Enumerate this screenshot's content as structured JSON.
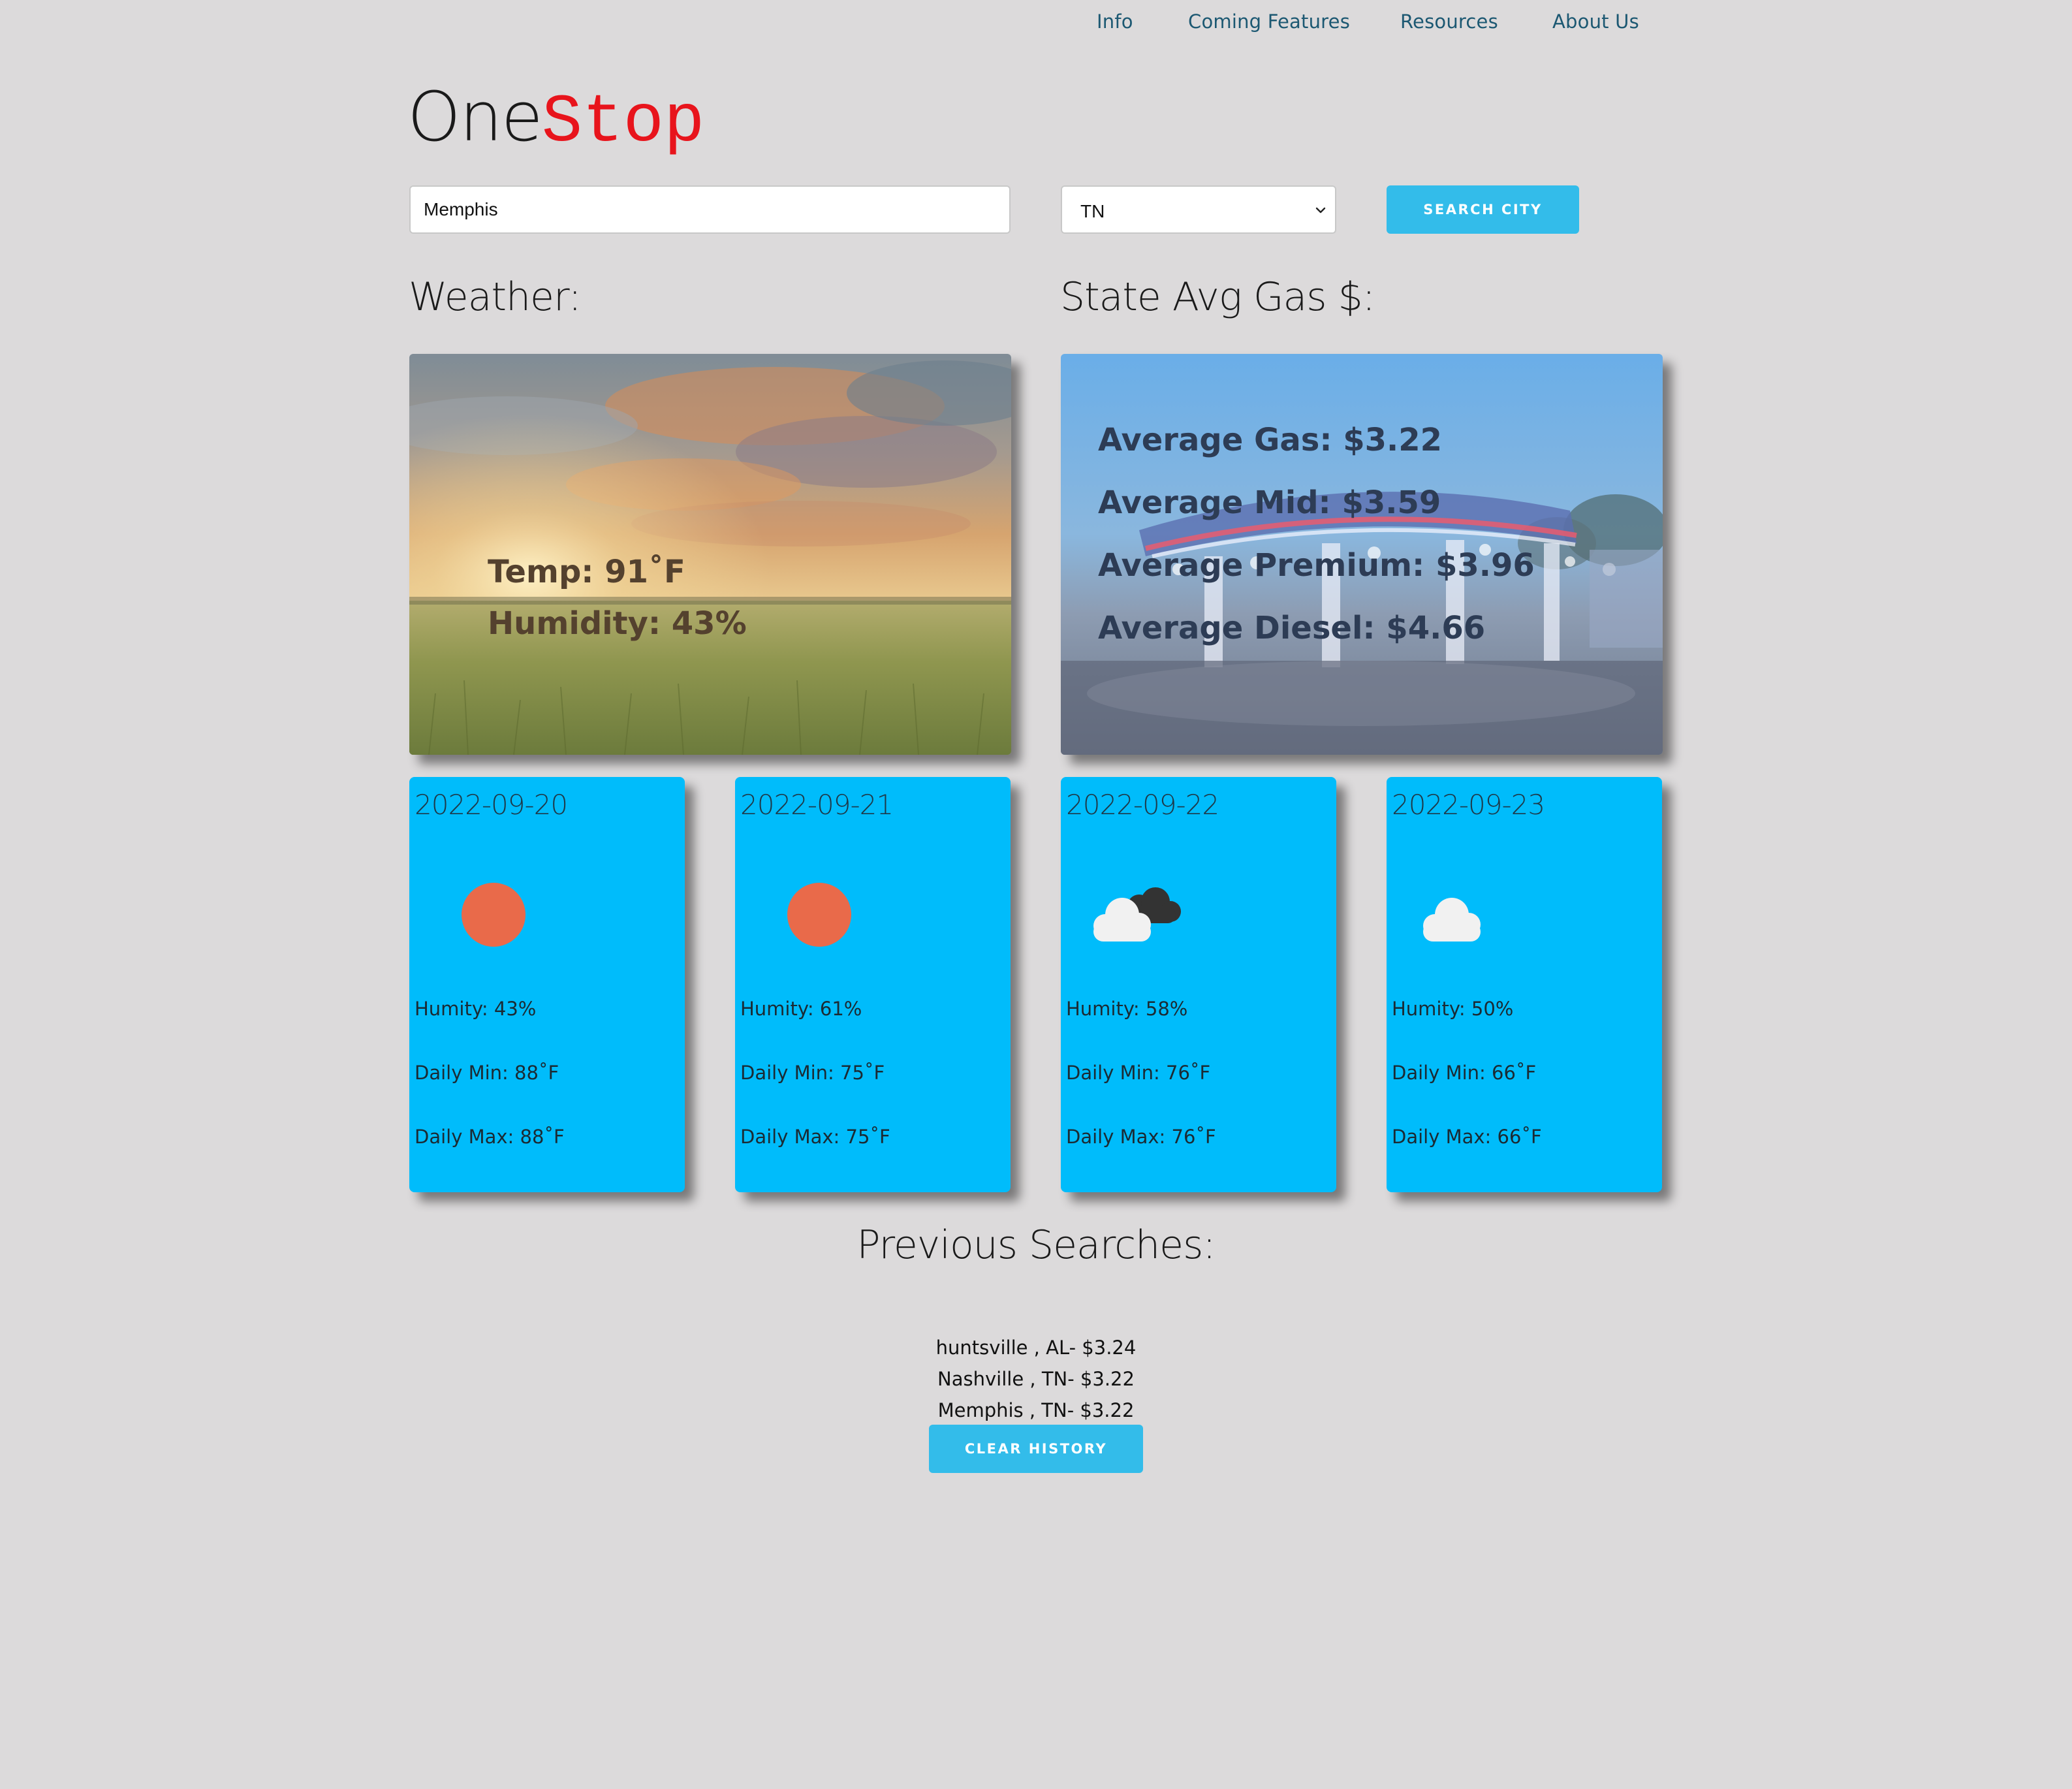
{
  "nav": {
    "items": [
      {
        "label": "Info"
      },
      {
        "label": "Coming Features"
      },
      {
        "label": "Resources"
      },
      {
        "label": "About Us"
      }
    ]
  },
  "logo": {
    "part1": "One",
    "part2": "Stop",
    "part2_color": "#e8141c"
  },
  "search": {
    "city_value": "Memphis",
    "state_selected": "TN",
    "button_label": "SEARCH CITY",
    "button_color": "#33bcea"
  },
  "weather": {
    "heading": "Weather:",
    "temp": "Temp: 91˚F",
    "humidity": "Humidity: 43%"
  },
  "gas": {
    "heading": "State Avg Gas $:",
    "lines": [
      "Average Gas: $3.22",
      "Average Mid: $3.59",
      "Average Premium: $3.96",
      "Average Diesel: $4.66"
    ]
  },
  "forecast": {
    "card_color": "#00bcfb",
    "days": [
      {
        "date": "2022-09-20",
        "icon": "sun-icon",
        "humidity": "Humity: 43%",
        "min": "Daily Min: 88˚F",
        "max": "Daily Max: 88˚F"
      },
      {
        "date": "2022-09-21",
        "icon": "sun-icon",
        "humidity": "Humity: 61%",
        "min": "Daily Min: 75˚F",
        "max": "Daily Max: 75˚F"
      },
      {
        "date": "2022-09-22",
        "icon": "dark-clouds-icon",
        "humidity": "Humity: 58%",
        "min": "Daily Min: 76˚F",
        "max": "Daily Max: 76˚F"
      },
      {
        "date": "2022-09-23",
        "icon": "cloud-icon",
        "humidity": "Humity: 50%",
        "min": "Daily Min: 66˚F",
        "max": "Daily Max: 66˚F"
      }
    ]
  },
  "history": {
    "heading": "Previous Searches:",
    "items": [
      "huntsville , AL- $3.24",
      "Nashville , TN- $3.22",
      "Memphis , TN- $3.22"
    ],
    "clear_label": "CLEAR HISTORY"
  }
}
